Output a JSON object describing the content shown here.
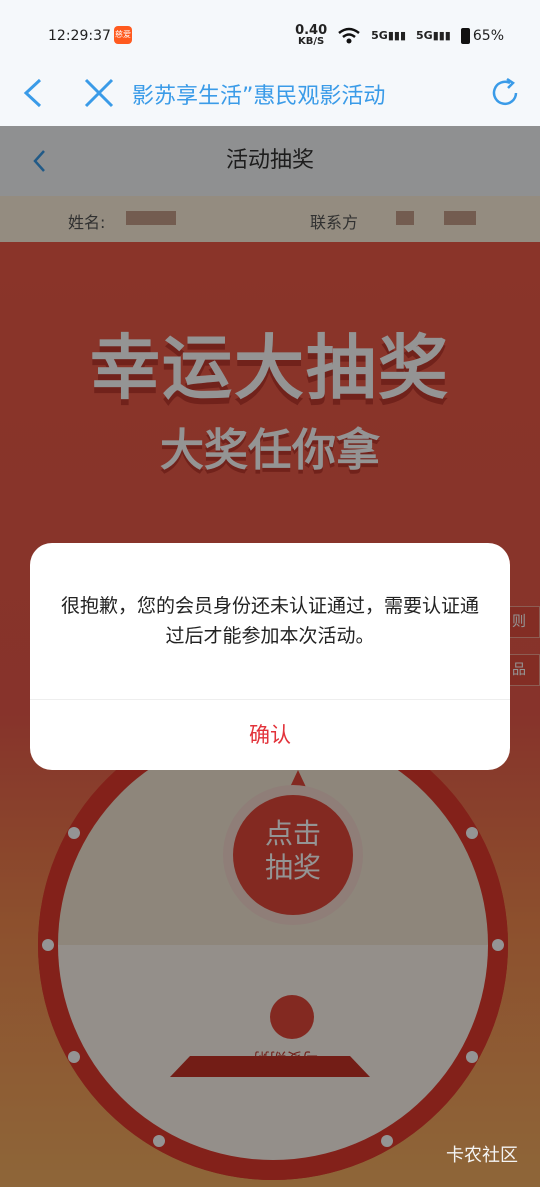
{
  "status_bar": {
    "time": "12:29:37",
    "app_badge": "慈爱",
    "net_speed_value": "0.40",
    "net_speed_unit": "KB/S",
    "signal1": "5G",
    "signal2": "5G",
    "battery": "65%"
  },
  "navbar": {
    "title": "影苏享生活”惠民观影活动"
  },
  "page": {
    "header_title": "活动抽奖",
    "name_label": "姓名:",
    "contact_label": "联系方",
    "hero_title": "幸运大抽奖",
    "hero_subtitle": "大奖任你拿",
    "side_tab_rules": "则",
    "side_tab_prizes": "品",
    "wheel_center_line1": "点击",
    "wheel_center_line2": "抽奖",
    "prize_text": "与麥期粥"
  },
  "dialog": {
    "message": "很抱歉，您的会员身份还未认证通过，需要认证通过后才能参加本次活动。",
    "confirm_label": "确认"
  },
  "watermark": "卡农社区",
  "colors": {
    "accent_blue": "#3a9be8",
    "dialog_confirm": "#e2323a",
    "hero_red": "#ee5b47"
  }
}
